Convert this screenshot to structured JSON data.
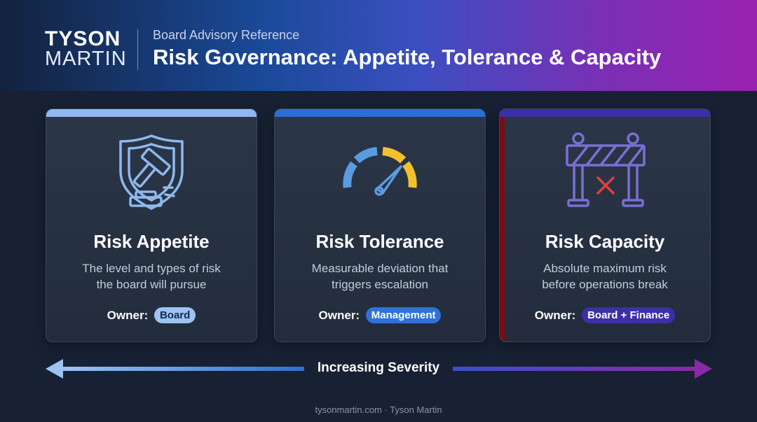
{
  "header": {
    "logo_line1": "TYSON",
    "logo_line2": "MARTIN",
    "subtitle": "Board Advisory Reference",
    "title": "Risk Governance: Appetite, Tolerance & Capacity"
  },
  "cards": [
    {
      "title": "Risk Appetite",
      "desc_line1": "The level and types of risk",
      "desc_line2": "the board will pursue",
      "owner_label": "Owner:",
      "owner_value": "Board",
      "icon": "shield-gavel-icon",
      "accent": "#8fb8ee"
    },
    {
      "title": "Risk Tolerance",
      "desc_line1": "Measurable deviation that",
      "desc_line2": "triggers escalation",
      "owner_label": "Owner:",
      "owner_value": "Management",
      "icon": "gauge-icon",
      "accent": "#2b6fd6"
    },
    {
      "title": "Risk Capacity",
      "desc_line1": "Absolute maximum risk",
      "desc_line2": "before operations break",
      "owner_label": "Owner:",
      "owner_value": "Board + Finance",
      "icon": "barrier-icon",
      "accent": "#3a2fa8"
    }
  ],
  "severity": {
    "label": "Increasing Severity"
  },
  "footer": {
    "text": "tysonmartin.com · Tyson Martin"
  },
  "colors": {
    "background": "#172133",
    "appetite_pill": "#9cc3f2",
    "tolerance_pill": "#2f72d8",
    "capacity_pill": "#3d2fa6",
    "gauge_blue": "#5b9be0",
    "gauge_yellow": "#f2c12e",
    "barrier_purple": "#7a6fd6",
    "danger_red": "#e0413f"
  }
}
